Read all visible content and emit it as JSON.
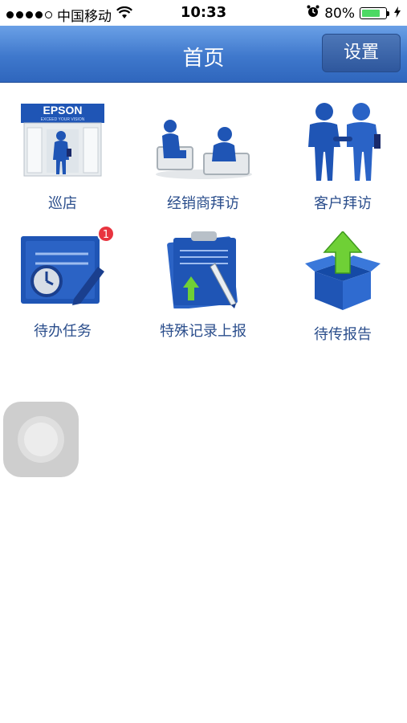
{
  "status_bar": {
    "carrier": "中国移动",
    "time": "10:33",
    "battery": "80%",
    "battery_level": 0.8,
    "signal_bars": 4
  },
  "nav": {
    "title": "首页",
    "settings_label": "设置"
  },
  "tiles": [
    {
      "label": "巡店",
      "icon": "store-visit-icon"
    },
    {
      "label": "经销商拜访",
      "icon": "dealer-visit-icon"
    },
    {
      "label": "客户拜访",
      "icon": "customer-visit-icon"
    },
    {
      "label": "待办任务",
      "icon": "todo-task-icon",
      "badge": "1"
    },
    {
      "label": "特殊记录上报",
      "icon": "special-record-icon"
    },
    {
      "label": "待传报告",
      "icon": "pending-upload-icon"
    }
  ],
  "icon_texts": {
    "store_logo": "EPSON",
    "store_slogan": "EXCEED YOUR VISION"
  },
  "colors": {
    "nav_blue": "#3f78cc",
    "label_blue": "#2b4e8c",
    "badge_red": "#e8343f",
    "battery_green": "#4cd964"
  }
}
